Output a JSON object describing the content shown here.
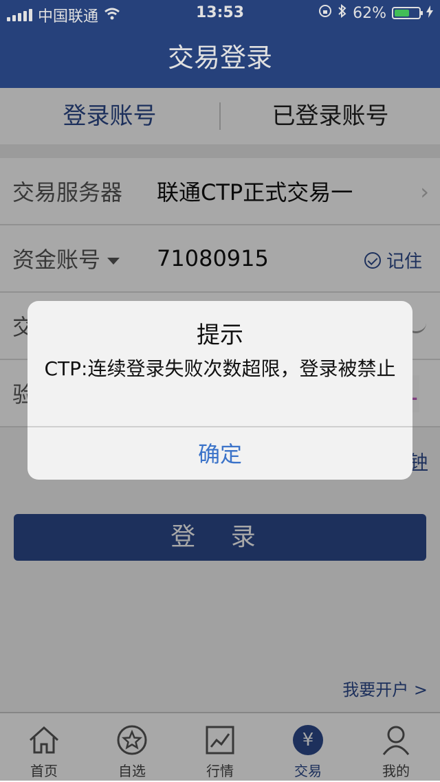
{
  "status": {
    "carrier": "中国联通",
    "time": "13:53",
    "battery": "62%",
    "battery_level": 0.62
  },
  "nav": {
    "title": "交易登录"
  },
  "tabs": [
    {
      "label": "登录账号",
      "active": true
    },
    {
      "label": "已登录账号",
      "active": false
    }
  ],
  "form": {
    "server_label": "交易服务器",
    "server_value": "联通CTP正式交易一",
    "account_label": "资金账号",
    "account_value": "71080915",
    "remember_label": "记住",
    "password_label": "交",
    "captcha_label": "验",
    "captcha_value": "1",
    "hint_text": "钟"
  },
  "login_button": "登 录",
  "open_account": "我要开户 >",
  "tabbar": [
    {
      "label": "首页",
      "icon": "home-icon"
    },
    {
      "label": "自选",
      "icon": "star-icon"
    },
    {
      "label": "行情",
      "icon": "chart-icon"
    },
    {
      "label": "交易",
      "icon": "yen-icon",
      "active": true
    },
    {
      "label": "我的",
      "icon": "user-icon"
    }
  ],
  "dialog": {
    "title": "提示",
    "message": "CTP:连续登录失败次数超限，登录被禁止",
    "confirm": "确定"
  },
  "colors": {
    "primary": "#2c4a8c",
    "link": "#3b73c9",
    "battery": "#4cd964"
  }
}
